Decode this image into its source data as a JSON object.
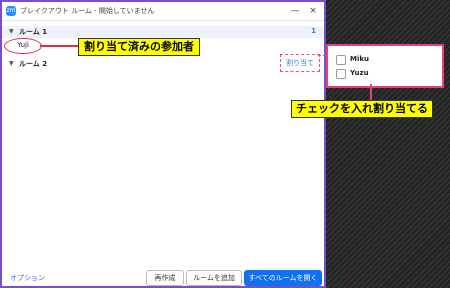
{
  "window": {
    "title": "ブレイクアウト ルーム - 開始していません",
    "app_icon": "zoom",
    "controls": {
      "minimize": "—",
      "close": "×"
    }
  },
  "rooms": [
    {
      "name": "ルーム 1",
      "count": "1",
      "participants": [
        "Yuji"
      ]
    },
    {
      "name": "ルーム 2",
      "count": "",
      "participants": []
    }
  ],
  "room2_assign_label": "割り当て",
  "assign_popup": {
    "options": [
      {
        "name": "Miku",
        "checked": false
      },
      {
        "name": "Yuzu",
        "checked": false
      }
    ]
  },
  "annotations": {
    "assigned_callout": "割り当て済みの参加者",
    "check_callout": "チェックを入れ割り当てる"
  },
  "footer": {
    "options_label": "オプション",
    "recreate_label": "再作成",
    "add_room_label": "ルームを追加",
    "open_all_label": "すべてのルームを開く"
  },
  "colors": {
    "accent": "#0e72ed",
    "frame": "#7a4cd0",
    "annotation_border": "#e8407a",
    "callout_bg": "#ffff00"
  }
}
